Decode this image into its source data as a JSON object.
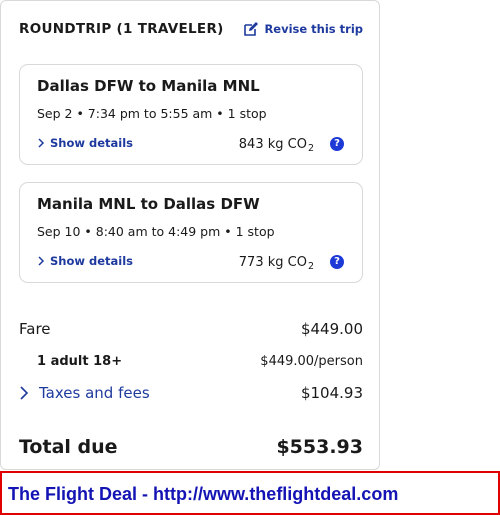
{
  "summary": {
    "trip_type": "ROUNDTRIP (1 TRAVELER)",
    "revise_label": "Revise this trip"
  },
  "flights": [
    {
      "route": "Dallas DFW to Manila MNL",
      "times": "Sep 2 • 7:34 pm to 5:55 am • 1 stop",
      "details_label": "Show details",
      "co2_value": "843 kg CO",
      "co2_sub": "2",
      "help_icon": "?"
    },
    {
      "route": "Manila MNL to Dallas DFW",
      "times": "Sep 10 • 8:40 am to 4:49 pm • 1 stop",
      "details_label": "Show details",
      "co2_value": "773 kg CO",
      "co2_sub": "2",
      "help_icon": "?"
    }
  ],
  "price": {
    "fare_label": "Fare",
    "fare_value": "$449.00",
    "adult_label": "1 adult 18+",
    "adult_value": "$449.00/person",
    "taxes_label": "Taxes and fees",
    "taxes_value": "$104.93",
    "total_label": "Total due",
    "total_value": "$553.93"
  },
  "banner": {
    "text": "The Flight Deal - http://www.theflightdeal.com"
  },
  "colors": {
    "link": "#1e3a9e",
    "help_badge": "#1e3ad6",
    "banner_border": "#e00000",
    "banner_text": "#1414b4"
  },
  "icons": {
    "revise": "edit-icon",
    "details": "chevron-right-icon",
    "help": "help-icon",
    "taxes": "chevron-right-icon"
  }
}
